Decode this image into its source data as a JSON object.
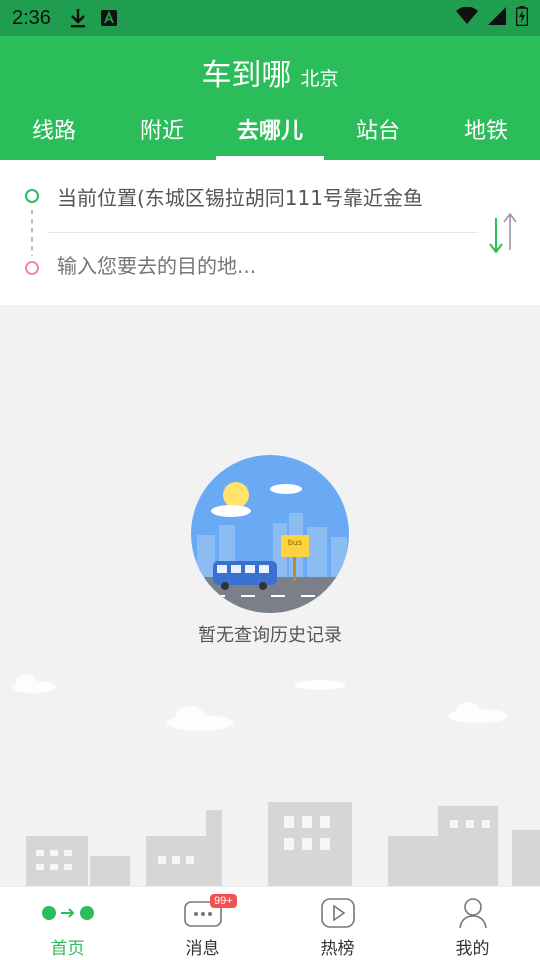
{
  "status_bar": {
    "time": "2:36"
  },
  "header": {
    "title": "车到哪",
    "city": "北京",
    "tabs": [
      {
        "label": "线路",
        "active": false
      },
      {
        "label": "附近",
        "active": false
      },
      {
        "label": "去哪儿",
        "active": true
      },
      {
        "label": "站台",
        "active": false
      },
      {
        "label": "地铁",
        "active": false
      }
    ]
  },
  "route": {
    "from_text": "当前位置(东城区锡拉胡同111号靠近金鱼",
    "to_placeholder": "输入您要去的目的地..."
  },
  "empty_state": {
    "message": "暂无查询历史记录",
    "illustration_sign": "bus"
  },
  "bottom_nav": {
    "items": [
      {
        "label": "首页",
        "icon": "route-home-icon",
        "active": true
      },
      {
        "label": "消息",
        "icon": "message-icon",
        "active": false,
        "badge": "99+"
      },
      {
        "label": "热榜",
        "icon": "play-icon",
        "active": false
      },
      {
        "label": "我的",
        "icon": "user-icon",
        "active": false
      }
    ]
  },
  "colors": {
    "brand": "#2cbd5b",
    "status_bar": "#1e9e4e",
    "badge": "#f0524f",
    "destination_dot": "#f08aa0"
  }
}
